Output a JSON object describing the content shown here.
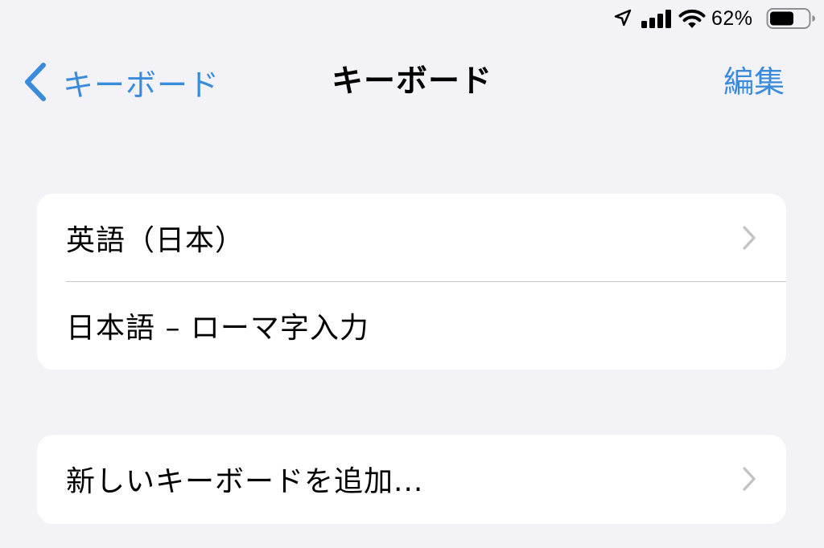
{
  "status_bar": {
    "battery_percent": "62%",
    "icons": [
      "location-arrow-icon",
      "cellular-signal-icon",
      "wifi-icon",
      "battery-icon"
    ]
  },
  "nav": {
    "back_label": "キーボード",
    "title": "キーボード",
    "edit_label": "編集"
  },
  "keyboards": {
    "items": [
      {
        "label": "英語（日本）",
        "has_chevron": true
      },
      {
        "label": "日本語 – ローマ字入力",
        "has_chevron": false
      }
    ]
  },
  "add_keyboard": {
    "label": "新しいキーボードを追加..."
  },
  "colors": {
    "accent": "#3a8bdc",
    "background": "#f2f2f7",
    "cell": "#ffffff",
    "separator": "#c6c6c8",
    "chevron": "#c4c4c6"
  }
}
